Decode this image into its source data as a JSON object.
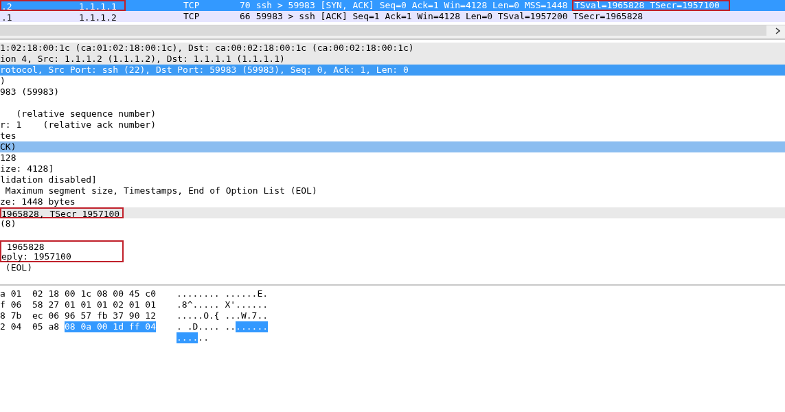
{
  "packet_list": {
    "rows": [
      {
        "number": ".2",
        "source": "1.1.1.1",
        "protocol": "TCP",
        "length": "70",
        "info": "ssh > 59983 [SYN, ACK] Seq=0 Ack=1 Win=4128 Len=0 MSS=1448",
        "info_extra": "TSval=1965828 TSecr=1957100",
        "boxed": true,
        "extra_boxed": true,
        "selected": true
      },
      {
        "number": ".1",
        "source": "1.1.1.2",
        "protocol": "TCP",
        "length": "66",
        "info": "59983 > ssh [ACK] Seq=1 Ack=1 Win=4128 Len=0 TSval=1957200 TSecr=1965828",
        "boxed": false,
        "selected": false
      }
    ]
  },
  "details": [
    {
      "text": "1:02:18:00:1c (ca:01:02:18:00:1c), Dst: ca:00:02:18:00:1c (ca:00:02:18:00:1c)",
      "kind": "layer",
      "boxed": false
    },
    {
      "text": "ion 4, Src: 1.1.1.2 (1.1.1.2), Dst: 1.1.1.1 (1.1.1.1)",
      "kind": "layer",
      "boxed": false
    },
    {
      "text": "rotocol, Src Port: ssh (22), Dst Port: 59983 (59983), Seq: 0, Ack: 1, Len: 0",
      "kind": "selected",
      "boxed": false
    },
    {
      "text": ")",
      "kind": "field",
      "boxed": false
    },
    {
      "text": "983 (59983)",
      "kind": "field",
      "boxed": false
    },
    {
      "kind": "field"
    },
    {
      "text": "   (relative sequence number)",
      "kind": "field",
      "boxed": false
    },
    {
      "text": "r: 1    (relative ack number)",
      "kind": "field",
      "boxed": false
    },
    {
      "text": "tes",
      "kind": "field",
      "boxed": false
    },
    {
      "text": "CK)",
      "kind": "related",
      "boxed": false
    },
    {
      "text": "128",
      "kind": "field",
      "boxed": false
    },
    {
      "text": "ize: 4128]",
      "kind": "field",
      "boxed": false
    },
    {
      "text": "lidation disabled]",
      "kind": "field",
      "boxed": false
    },
    {
      "text": " Maximum segment size, Timestamps, End of Option List (EOL)",
      "kind": "field",
      "boxed": false
    },
    {
      "text": "ze: 1448 bytes",
      "kind": "field",
      "boxed": false
    },
    {
      "text": "1965828, TSecr 1957100",
      "kind": "layer",
      "boxed": true
    },
    {
      "text": "(8)",
      "kind": "field",
      "boxed": false
    },
    {
      "kind": "field"
    },
    {
      "text": " 1965828",
      "kind": "field",
      "boxed": true
    },
    {
      "text": "eply: 1957100",
      "kind": "field",
      "boxed": true
    },
    {
      "text": " (EOL)",
      "kind": "field",
      "boxed": false
    }
  ],
  "hex_dump": [
    {
      "hex": "a 01  02 18 00 1c 08 00 45 c0",
      "ascii": "........ ......E."
    },
    {
      "hex": "f 06  58 27 01 01 01 02 01 01",
      "ascii": ".8^..... X'......"
    },
    {
      "hex": "8 7b  ec 06 96 57 fb 37 90 12",
      "ascii": ".....O.{ ...W.7.."
    },
    {
      "hex": "2 04  05 a8 ",
      "hex_selected": "08 0a 00 1d ff 04",
      "ascii": ". .D.... ..",
      "ascii_selected": "......"
    },
    {
      "ascii_selected": "....",
      "ascii": ".."
    }
  ]
}
